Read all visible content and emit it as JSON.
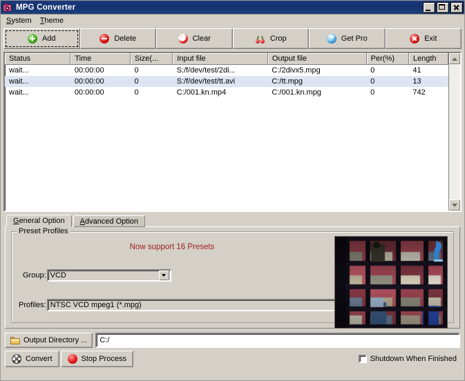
{
  "window": {
    "title": "MPG Converter",
    "icon": "camera-icon",
    "minimize_label": "Minimize",
    "maximize_label": "Maximize",
    "close_label": "Close"
  },
  "menu": {
    "items": [
      {
        "label": "System",
        "accel": "S"
      },
      {
        "label": "Theme",
        "accel": "T"
      }
    ]
  },
  "toolbar": {
    "buttons": [
      {
        "label": "Add",
        "icon": "add-circle-icon",
        "focused": true
      },
      {
        "label": "Delete",
        "icon": "delete-circle-icon",
        "focused": false
      },
      {
        "label": "Clear",
        "icon": "clear-circle-icon",
        "focused": false
      },
      {
        "label": "Crop",
        "icon": "cherries-icon",
        "focused": false
      },
      {
        "label": "Get Pro",
        "icon": "blue-sphere-icon",
        "focused": false
      },
      {
        "label": "Exit",
        "icon": "exit-circle-icon",
        "focused": false
      }
    ]
  },
  "filelist": {
    "columns": [
      "Status",
      "Time",
      "Size(...",
      "Input file",
      "Output file",
      "Per(%)",
      "Length"
    ],
    "rows": [
      {
        "status": "wait...",
        "time": "00:00:00",
        "size": "0",
        "input": "S:/f/dev/test/2di...",
        "output": "C:/2divx5.mpg",
        "percent": "0",
        "length": "41",
        "selected": false
      },
      {
        "status": "wait...",
        "time": "00:00:00",
        "size": "0",
        "input": "S:/f/dev/test/tt.avi",
        "output": "C:/tt.mpg",
        "percent": "0",
        "length": "13",
        "selected": true
      },
      {
        "status": "wait...",
        "time": "00:00:00",
        "size": "0",
        "input": "C:/001.kn.mp4",
        "output": "C:/001.kn.mpg",
        "percent": "0",
        "length": "742",
        "selected": false
      }
    ]
  },
  "tabs": [
    {
      "label": "General Option",
      "accel": "G",
      "active": true
    },
    {
      "label": "Advanced Option",
      "accel": "A",
      "active": false
    }
  ],
  "preset_profiles": {
    "group_title": "Preset Profiles",
    "note": "Now support 16 Presets",
    "note_color": "#a02020",
    "group_label": "Group:",
    "group_value": "VCD",
    "profiles_label": "Profiles:",
    "profiles_value": "NTSC VCD mpeg1 (*.mpg)",
    "preview_name": "video-preview-thumbnail"
  },
  "output": {
    "directory_button": "Output Directory ...",
    "directory_icon": "folder-icon",
    "path_value": "C:/",
    "path_placeholder": ""
  },
  "bottom": {
    "convert_label": "Convert",
    "convert_icon": "film-reel-icon",
    "stop_label": "Stop Process",
    "stop_icon": "stop-circle-icon",
    "shutdown_label": "Shutdown When Finished",
    "shutdown_checked": false
  }
}
